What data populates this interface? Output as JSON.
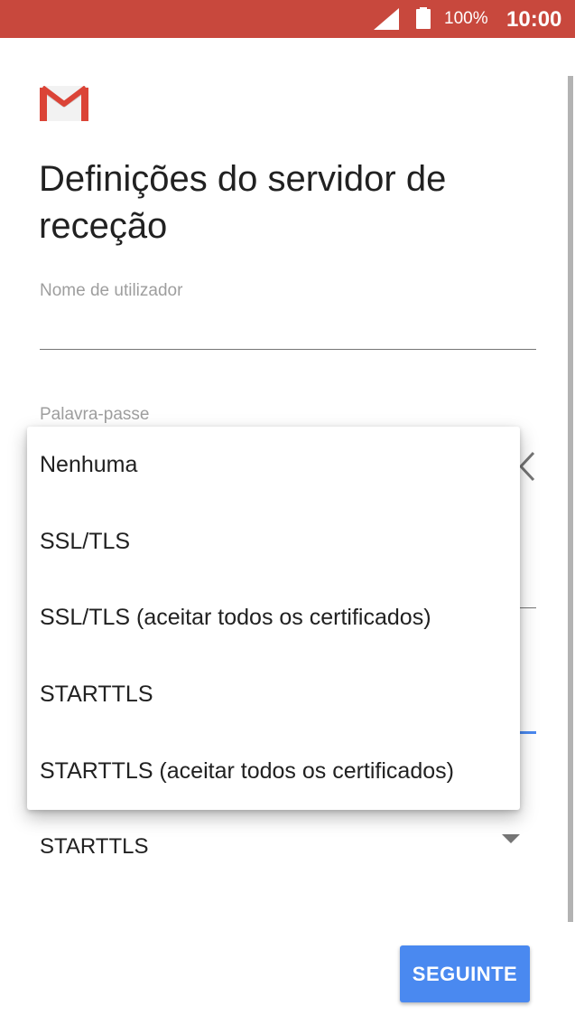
{
  "status_bar": {
    "battery_text": "100%",
    "time": "10:00",
    "background": "#c8483d"
  },
  "app": {
    "logo_icon": "gmail-icon"
  },
  "page": {
    "title": "Definições do servidor de receção"
  },
  "form": {
    "username_label": "Nome de utilizador",
    "username_value": "",
    "password_label": "Palavra-passe",
    "security_value": "STARTTLS"
  },
  "security_menu": {
    "options": [
      "Nenhuma",
      "SSL/TLS",
      "SSL/TLS (aceitar todos os certificados)",
      "STARTTLS",
      "STARTTLS (aceitar todos os certificados)"
    ]
  },
  "footer": {
    "next_label": "SEGUINTE"
  },
  "colors": {
    "accent": "#4a89f0",
    "status_bar": "#c8483d"
  }
}
